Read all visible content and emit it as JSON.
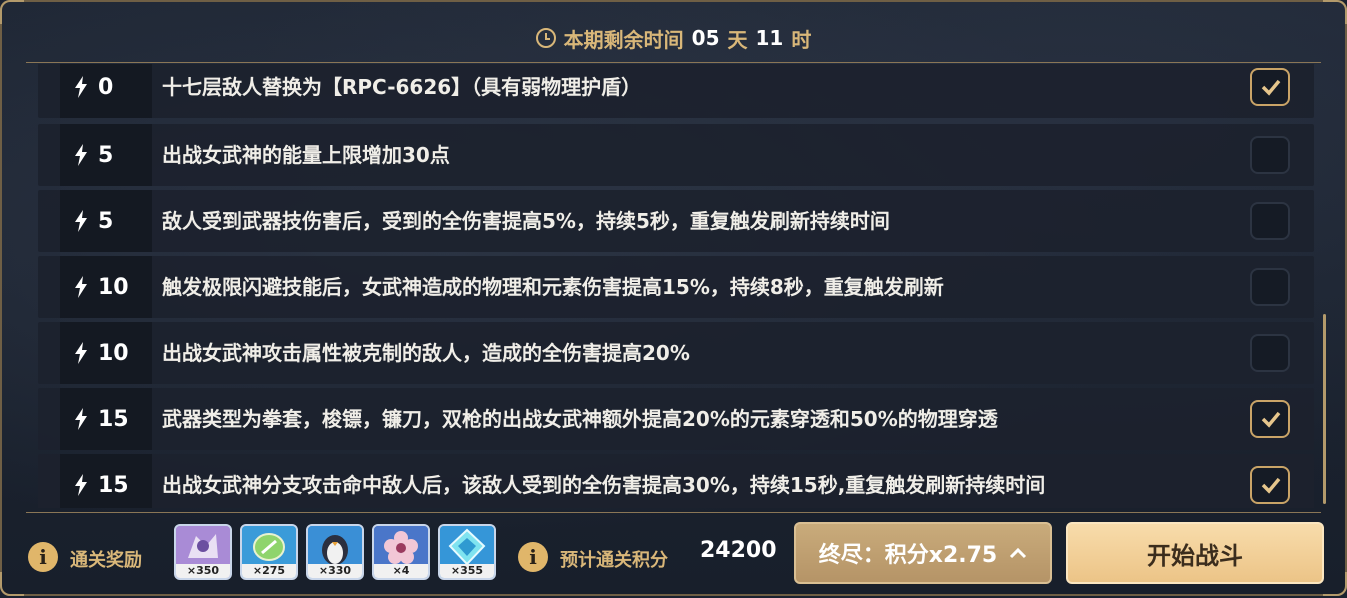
{
  "timer": {
    "label": "本期剩余时间",
    "days": "05",
    "day_unit": "天",
    "hours": "11",
    "hour_unit": "时"
  },
  "buffs": [
    {
      "cost": "0",
      "text": "十七层敌人替换为【RPC-6626】（具有弱物理护盾）",
      "checked": true
    },
    {
      "cost": "5",
      "text": "出战女武神的能量上限增加30点",
      "checked": false
    },
    {
      "cost": "5",
      "text": "敌人受到武器技伤害后，受到的全伤害提高5%，持续5秒，重复触发刷新持续时间",
      "checked": false
    },
    {
      "cost": "10",
      "text": "触发极限闪避技能后，女武神造成的物理和元素伤害提高15%，持续8秒，重复触发刷新",
      "checked": false
    },
    {
      "cost": "10",
      "text": "出战女武神攻击属性被克制的敌人，造成的全伤害提高20%",
      "checked": false
    },
    {
      "cost": "15",
      "text": "武器类型为拳套，梭镖，镰刀，双枪的出战女武神额外提高20%的元素穿透和50%的物理穿透",
      "checked": true
    },
    {
      "cost": "15",
      "text": "出战女武神分支攻击命中敌人后，该敌人受到的全伤害提高30%，持续15秒,重复触发刷新持续时间",
      "checked": true
    }
  ],
  "footer": {
    "reward_label": "通关奖励",
    "rewards": [
      {
        "icon": "valkyrie-fragment-icon",
        "qty": "×350",
        "color": "#a98bd6"
      },
      {
        "icon": "coin-icon",
        "qty": "×275",
        "color": "#3a9bd9"
      },
      {
        "icon": "penguin-icon",
        "qty": "×330",
        "color": "#3a8fd6"
      },
      {
        "icon": "flower-icon",
        "qty": "×4",
        "color": "#4a76c9"
      },
      {
        "icon": "crystal-icon",
        "qty": "×355",
        "color": "#3596d8"
      }
    ],
    "score_label": "预计通关积分",
    "score_value": "24200",
    "mode_label": "终尽：积分x2.75",
    "start_label": "开始战斗"
  },
  "colors": {
    "gold": "#d9b779",
    "check_border": "#c9a467",
    "start_bg": "#f2cf95"
  }
}
